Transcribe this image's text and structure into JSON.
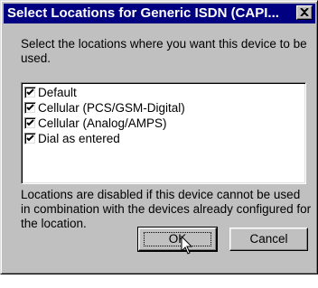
{
  "window": {
    "title": "Select Locations for Generic ISDN (CAPI..."
  },
  "instruction": "Select the locations where you want this device to be used.",
  "locations": [
    {
      "label": "Default",
      "checked": true
    },
    {
      "label": "Cellular (PCS/GSM-Digital)",
      "checked": true
    },
    {
      "label": "Cellular (Analog/AMPS)",
      "checked": true
    },
    {
      "label": "Dial as entered",
      "checked": true
    }
  ],
  "note": "Locations are disabled if this device cannot be used in combination with the devices already configured for the location.",
  "buttons": {
    "ok_label": "OK",
    "cancel_label": "Cancel"
  },
  "icons": {
    "close": "close-icon",
    "checkmark": "checkmark-icon",
    "cursor": "mouse-pointer-icon"
  }
}
